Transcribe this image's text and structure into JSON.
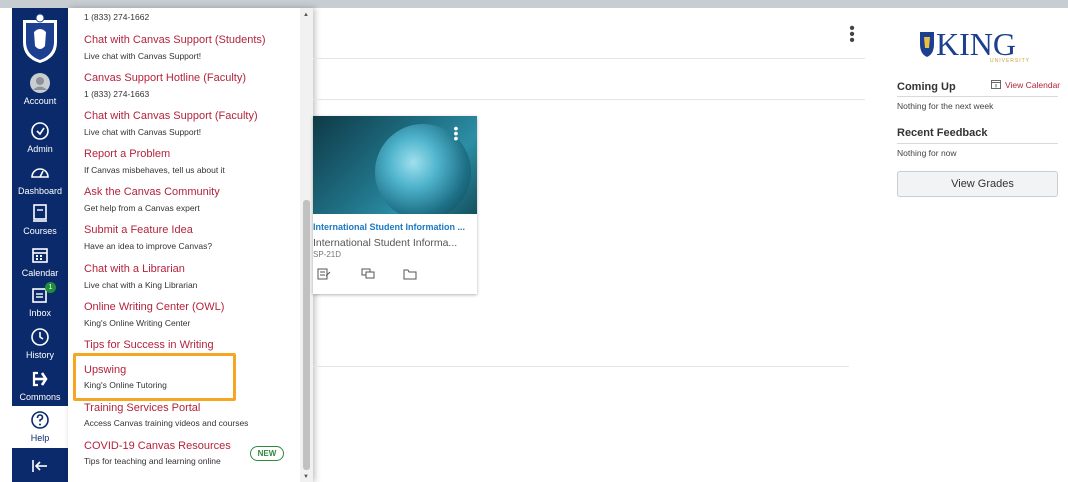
{
  "global_nav": {
    "items": [
      {
        "label": "Account",
        "icon": "account-icon"
      },
      {
        "label": "Admin",
        "icon": "admin-shield-icon"
      },
      {
        "label": "Dashboard",
        "icon": "dashboard-icon"
      },
      {
        "label": "Courses",
        "icon": "courses-icon"
      },
      {
        "label": "Calendar",
        "icon": "calendar-icon"
      },
      {
        "label": "Inbox",
        "icon": "inbox-icon",
        "badge": "1"
      },
      {
        "label": "History",
        "icon": "history-icon"
      },
      {
        "label": "Commons",
        "icon": "commons-icon"
      },
      {
        "label": "Help",
        "icon": "help-icon"
      }
    ],
    "collapse_icon": "collapse-nav-icon",
    "brand_color": "#0b2a6b"
  },
  "help_tray": {
    "top_phone": "1 (833) 274-1662",
    "items": [
      {
        "title": "Chat with Canvas Support (Students)",
        "desc": "Live chat with Canvas Support!"
      },
      {
        "title": "Canvas Support Hotline (Faculty)",
        "desc": "1 (833) 274-1663"
      },
      {
        "title": "Chat with Canvas Support (Faculty)",
        "desc": "Live chat with Canvas Support!"
      },
      {
        "title": "Report a Problem",
        "desc": "If Canvas misbehaves, tell us about it"
      },
      {
        "title": "Ask the Canvas Community",
        "desc": "Get help from a Canvas expert"
      },
      {
        "title": "Submit a Feature Idea",
        "desc": "Have an idea to improve Canvas?"
      },
      {
        "title": "Chat with a Librarian",
        "desc": "Live chat with a King Librarian"
      },
      {
        "title": "Online Writing Center (OWL)",
        "desc": "King's Online Writing Center"
      },
      {
        "title": "Tips for Success in Writing",
        "desc": ""
      },
      {
        "title": "Upswing",
        "desc": "King's Online Tutoring"
      },
      {
        "title": "Training Services Portal",
        "desc": "Access Canvas training videos and courses"
      },
      {
        "title": "COVID-19 Canvas Resources",
        "desc": "Tips for teaching and learning online",
        "badge": "NEW"
      }
    ],
    "link_color": "#b4233c",
    "highlight_color": "#f5a623"
  },
  "course_card": {
    "title": "International Student Information ...",
    "subtitle": "International Student Informa...",
    "code": "SP-21D"
  },
  "sidebar": {
    "logo_text": "KING",
    "logo_subtext": "UNIVERSITY",
    "coming_up_title": "Coming Up",
    "view_calendar": "View Calendar",
    "coming_up_text": "Nothing for the next week",
    "feedback_title": "Recent Feedback",
    "feedback_text": "Nothing for now",
    "view_grades": "View Grades"
  }
}
